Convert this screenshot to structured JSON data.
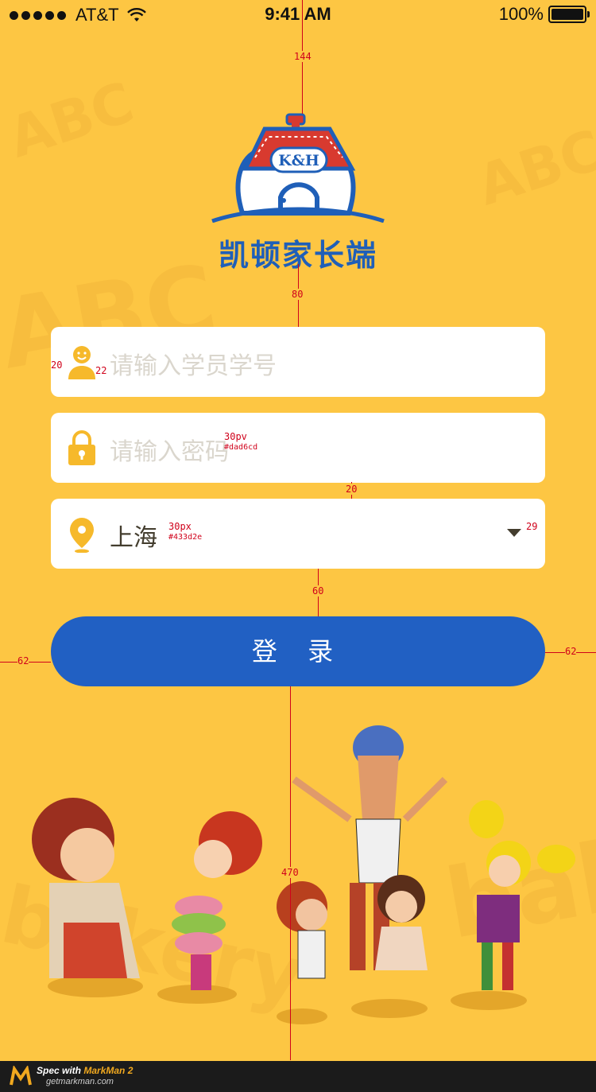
{
  "status_bar": {
    "carrier": "AT&T",
    "time": "9:41 AM",
    "battery": "100%"
  },
  "logo": {
    "badge_text": "K&H",
    "app_title": "凯顿家长端"
  },
  "form": {
    "student_id_placeholder": "请输入学员学号",
    "password_placeholder": "请输入密码",
    "city_value": "上海",
    "login_label": "登 录"
  },
  "annotations": {
    "a144": "144",
    "a80": "80",
    "a20a": "20",
    "a22": "22",
    "a30pv": "30pv",
    "col_dad6cd": "#dad6cd",
    "a20b": "20",
    "a30px": "30px",
    "col_433d2e": "#433d2e",
    "a29": "29",
    "a60": "60",
    "a62l": "62",
    "a62r": "62",
    "a470": "470"
  },
  "footer": {
    "spec_prefix": "Spec with",
    "spec_brand": "MarkMan 2",
    "site": "getmarkman.com"
  },
  "background": {
    "word_abc": "ABC",
    "word_bakery": "bakery"
  },
  "colors": {
    "background": "#fdc643",
    "primary_blue": "#2160c3",
    "placeholder": "#dad6cd",
    "text": "#433d2e",
    "icon_yellow": "#f6b92b"
  },
  "icons": [
    "user-icon",
    "lock-icon",
    "location-pin-icon",
    "dropdown-caret-icon",
    "wifi-icon",
    "battery-icon"
  ]
}
